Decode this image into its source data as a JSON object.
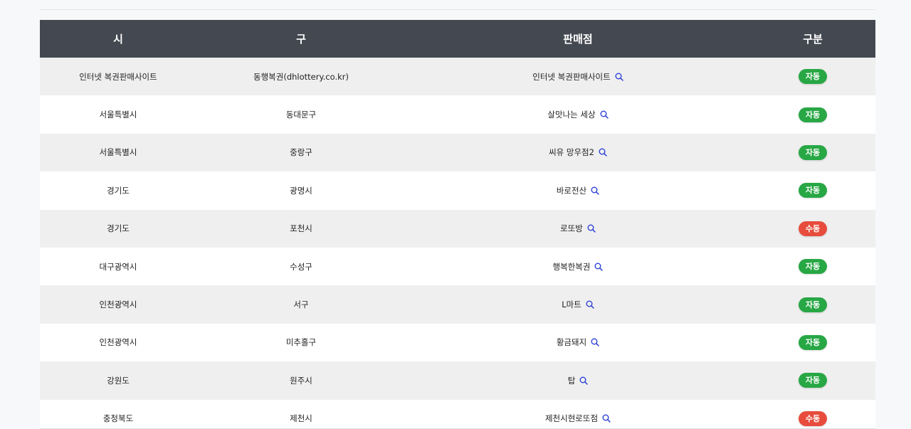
{
  "table": {
    "headers": [
      "시",
      "구",
      "판매점",
      "구분"
    ],
    "rows": [
      {
        "city": "인터넷 복권판매사이트",
        "district": "동행복권(dhlottery.co.kr)",
        "shop": "인터넷 복권판매사이트",
        "type": "자동"
      },
      {
        "city": "서울특별시",
        "district": "동대문구",
        "shop": "살맛나는 세상",
        "type": "자동"
      },
      {
        "city": "서울특별시",
        "district": "중랑구",
        "shop": "씨유 망우점2",
        "type": "자동"
      },
      {
        "city": "경기도",
        "district": "광명시",
        "shop": "바로전산",
        "type": "자동"
      },
      {
        "city": "경기도",
        "district": "포천시",
        "shop": "로또방",
        "type": "수동"
      },
      {
        "city": "대구광역시",
        "district": "수성구",
        "shop": "행복한복권",
        "type": "자동"
      },
      {
        "city": "인천광역시",
        "district": "서구",
        "shop": "L마트",
        "type": "자동"
      },
      {
        "city": "인천광역시",
        "district": "미추홀구",
        "shop": "황금돼지",
        "type": "자동"
      },
      {
        "city": "강원도",
        "district": "원주시",
        "shop": "탑",
        "type": "자동"
      },
      {
        "city": "충청북도",
        "district": "제천시",
        "shop": "제천시현로또점",
        "type": "수동"
      }
    ]
  },
  "colors": {
    "header_bg": "#444851",
    "auto_badge": "#28a745",
    "manual_badge": "#e74c3c",
    "search_icon": "#2b3fd6"
  },
  "icons": {
    "shop_search": "search-icon"
  }
}
